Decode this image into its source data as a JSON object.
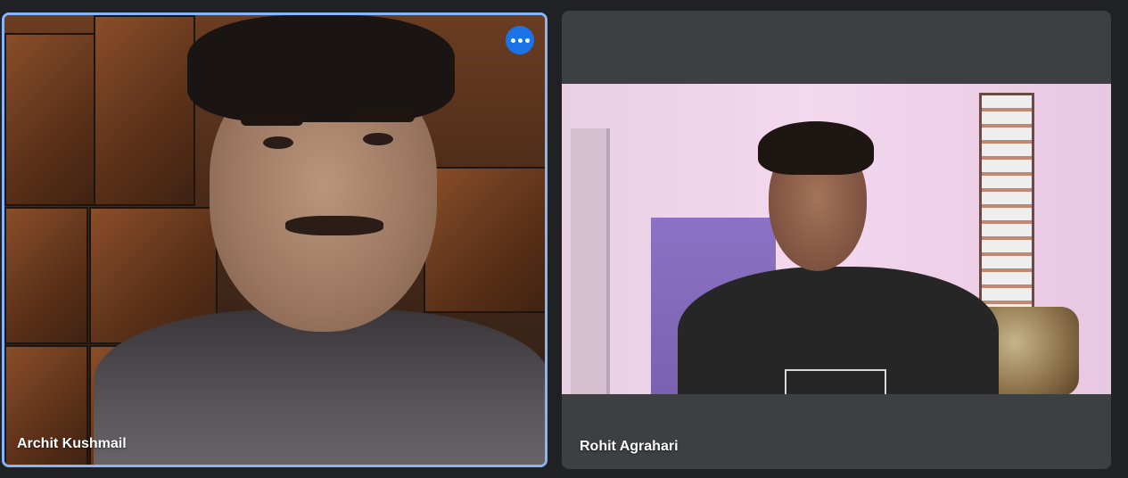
{
  "participants": [
    {
      "name": "Archit Kushmail",
      "active_speaker": true,
      "menu_icon": "more-options-icon"
    },
    {
      "name": "Rohit Agrahari",
      "active_speaker": false
    }
  ],
  "colors": {
    "background": "#202124",
    "tile_background": "#3c4043",
    "active_border": "#8ab4f8",
    "menu_button": "#1a73e8"
  }
}
